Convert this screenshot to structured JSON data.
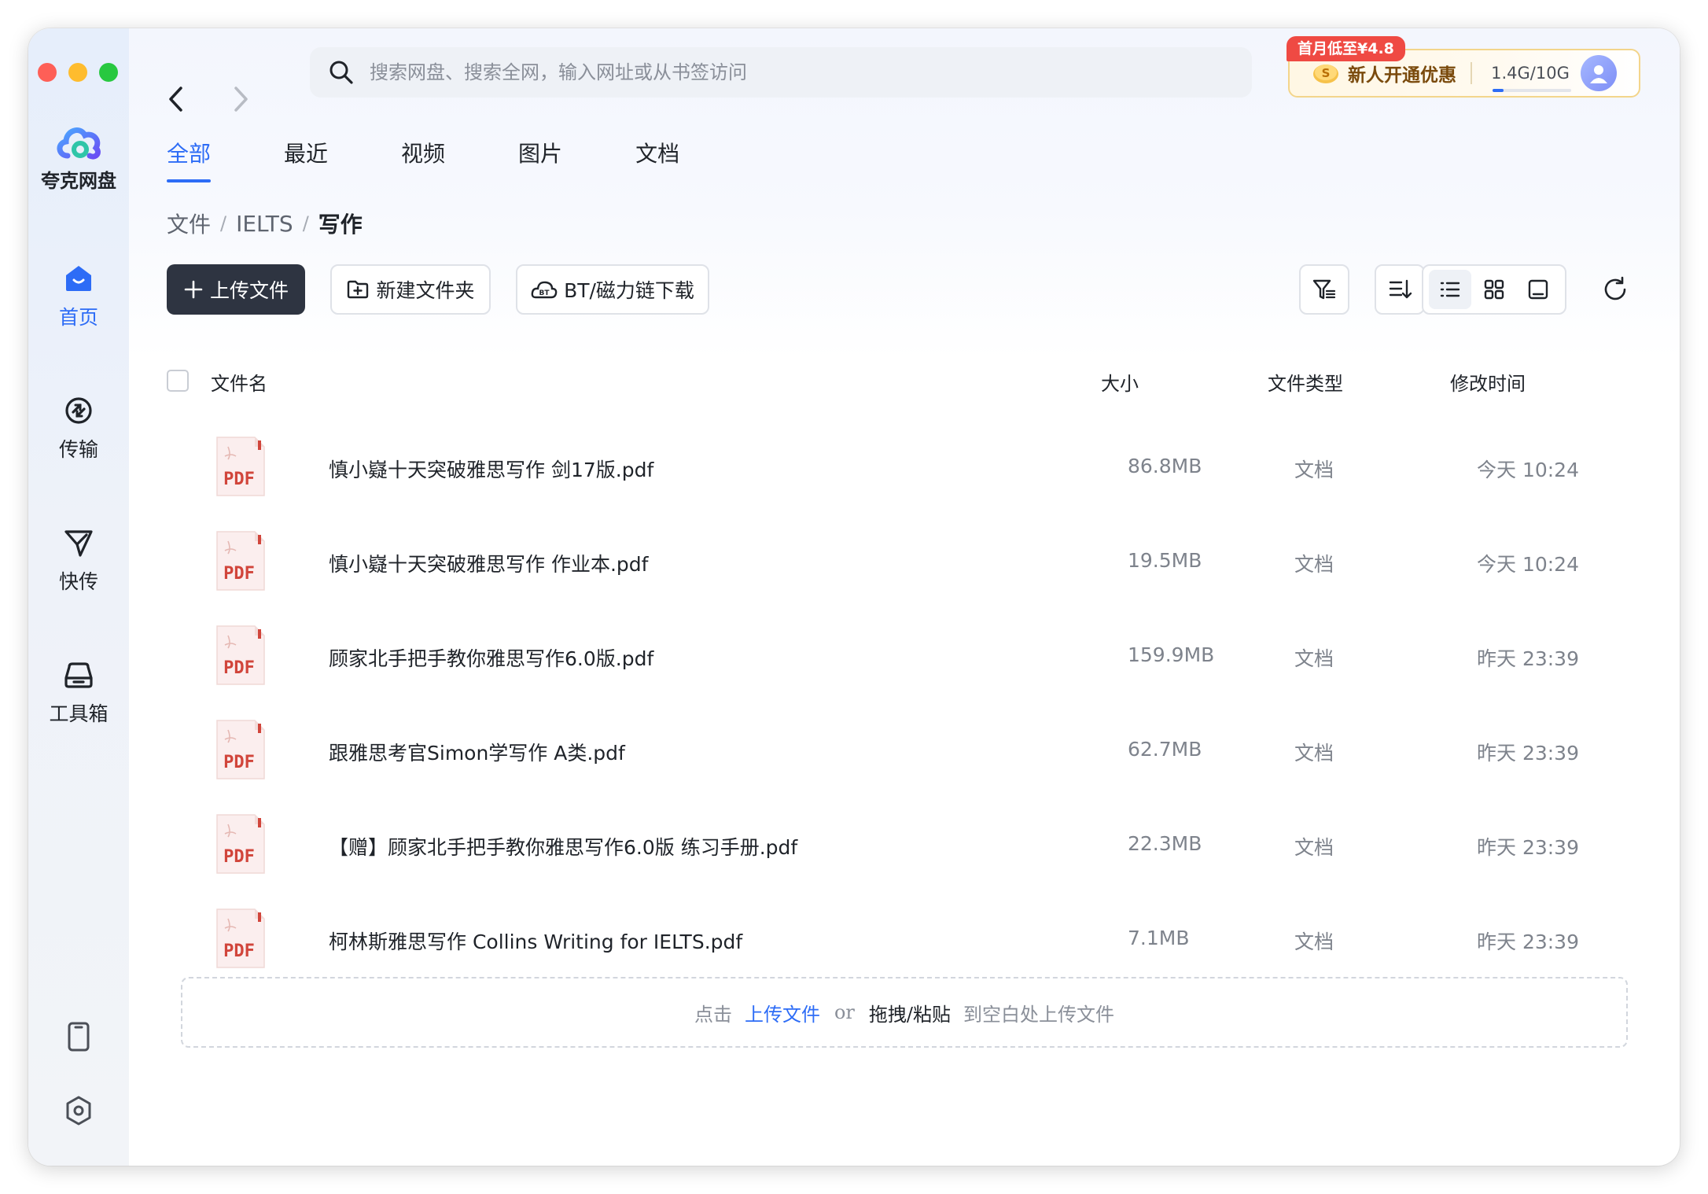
{
  "app": {
    "name": "夸克网盘"
  },
  "sidebar": {
    "items": [
      {
        "label": "首页",
        "icon": "home-icon",
        "active": true
      },
      {
        "label": "传输",
        "icon": "transfer-icon",
        "active": false
      },
      {
        "label": "快传",
        "icon": "send-icon",
        "active": false
      },
      {
        "label": "工具箱",
        "icon": "toolbox-icon",
        "active": false
      }
    ],
    "bottom_icons": [
      "phone-icon",
      "settings-icon"
    ]
  },
  "search": {
    "placeholder": "搜索网盘、搜索全网，输入网址或从书签访问",
    "value": ""
  },
  "promo": {
    "badge": "首月低至¥4.8",
    "text": "新人开通优惠",
    "storage": "1.4G/10G",
    "storage_fraction": 0.14
  },
  "tabs": [
    {
      "label": "全部",
      "active": true
    },
    {
      "label": "最近",
      "active": false
    },
    {
      "label": "视频",
      "active": false
    },
    {
      "label": "图片",
      "active": false
    },
    {
      "label": "文档",
      "active": false
    }
  ],
  "breadcrumb": [
    "文件",
    "IELTS",
    "写作"
  ],
  "toolbar": {
    "upload": "上传文件",
    "new_folder": "新建文件夹",
    "bt_download": "BT/磁力链下载"
  },
  "table": {
    "headers": {
      "name": "文件名",
      "size": "大小",
      "type": "文件类型",
      "modified": "修改时间"
    },
    "file_icon_label": "PDF",
    "rows": [
      {
        "name": "慎小嶷十天突破雅思写作 剑17版.pdf",
        "size": "86.8MB",
        "type": "文档",
        "modified": "今天 10:24"
      },
      {
        "name": "慎小嶷十天突破雅思写作 作业本.pdf",
        "size": "19.5MB",
        "type": "文档",
        "modified": "今天 10:24"
      },
      {
        "name": "顾家北手把手教你雅思写作6.0版.pdf",
        "size": "159.9MB",
        "type": "文档",
        "modified": "昨天 23:39"
      },
      {
        "name": "跟雅思考官Simon学写作 A类.pdf",
        "size": "62.7MB",
        "type": "文档",
        "modified": "昨天 23:39"
      },
      {
        "name": "【赠】顾家北手把手教你雅思写作6.0版 练习手册.pdf",
        "size": "22.3MB",
        "type": "文档",
        "modified": "昨天 23:39"
      },
      {
        "name": "柯林斯雅思写作 Collins Writing for IELTS.pdf",
        "size": "7.1MB",
        "type": "文档",
        "modified": "昨天 23:39"
      }
    ]
  },
  "dropzone": {
    "prefix": "点击",
    "upload_link": "上传文件",
    "or": "or",
    "drag": "拖拽/粘贴",
    "suffix": "到空白处上传文件"
  },
  "colors": {
    "accent": "#2d6cf6",
    "primary_button": "#2e3441",
    "pdf_red": "#d1453b",
    "promo_badge": "#ef4a43"
  }
}
